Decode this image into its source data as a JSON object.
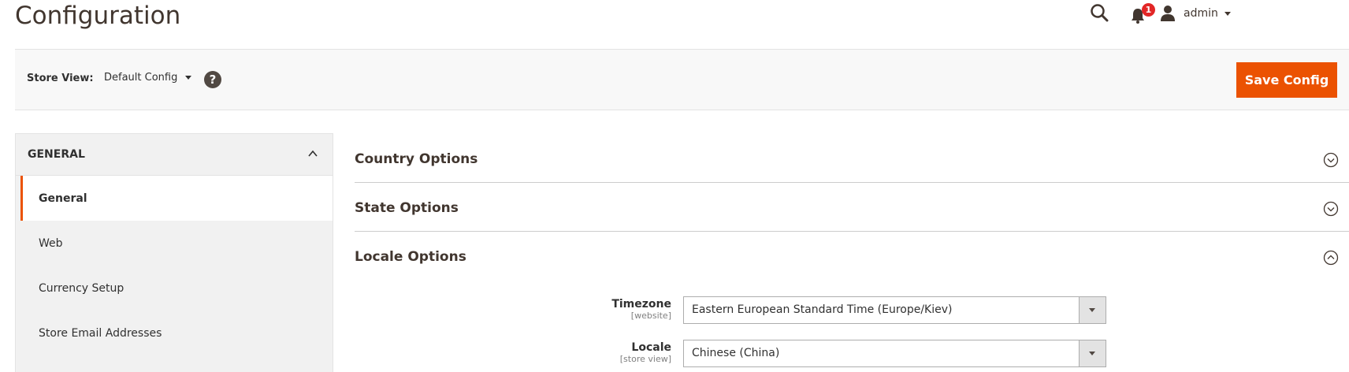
{
  "header": {
    "title": "Configuration",
    "notification_count": "1",
    "user_name": "admin"
  },
  "store_bar": {
    "label": "Store View:",
    "value": "Default Config",
    "help_glyph": "?",
    "save_label": "Save Config"
  },
  "sidebar": {
    "group_title": "GENERAL",
    "items": [
      {
        "label": "General",
        "active": true
      },
      {
        "label": "Web",
        "active": false
      },
      {
        "label": "Currency Setup",
        "active": false
      },
      {
        "label": "Store Email Addresses",
        "active": false
      }
    ]
  },
  "sections": [
    {
      "title": "Country Options",
      "state": "collapsed"
    },
    {
      "title": "State Options",
      "state": "collapsed"
    },
    {
      "title": "Locale Options",
      "state": "expanded"
    }
  ],
  "locale_fields": [
    {
      "label": "Timezone",
      "scope": "[website]",
      "value": "Eastern European Standard Time (Europe/Kiev)"
    },
    {
      "label": "Locale",
      "scope": "[store view]",
      "value": "Chinese (China)"
    }
  ],
  "colors": {
    "accent": "#eb5202",
    "badge": "#e22626",
    "title": "#41362f"
  },
  "icons": {
    "search": "search-icon",
    "notifications": "bell-icon",
    "user": "user-icon",
    "help": "help-icon",
    "collapse": "chevron-up-icon",
    "section_closed": "circle-chevron-down-icon",
    "section_open": "circle-chevron-up-icon",
    "select_arrow": "caret-down-icon"
  }
}
